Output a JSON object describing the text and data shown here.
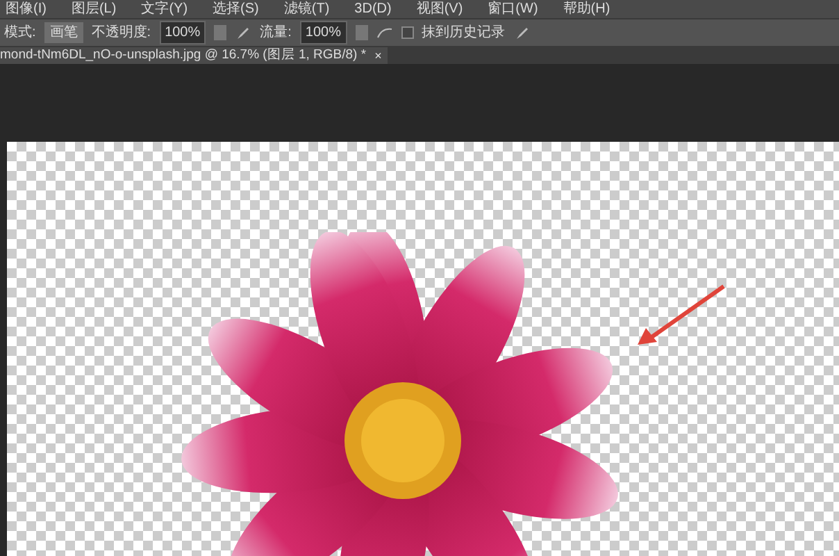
{
  "menu": [
    "图像(I)",
    "图层(L)",
    "文字(Y)",
    "选择(S)",
    "滤镜(T)",
    "3D(D)",
    "视图(V)",
    "窗口(W)",
    "帮助(H)"
  ],
  "options": {
    "mode_label": "模式:",
    "mode_value": "画笔",
    "opacity_label": "不透明度:",
    "opacity_value": "100%",
    "flow_label": "流量:",
    "flow_value": "100%",
    "history": {
      "label": "抹到历史记录",
      "checked": false
    }
  },
  "document_tab": {
    "title": "mond-tNm6DL_nO-o-unsplash.jpg @ 16.7% (图层 1, RGB/8) *",
    "close": "×"
  }
}
